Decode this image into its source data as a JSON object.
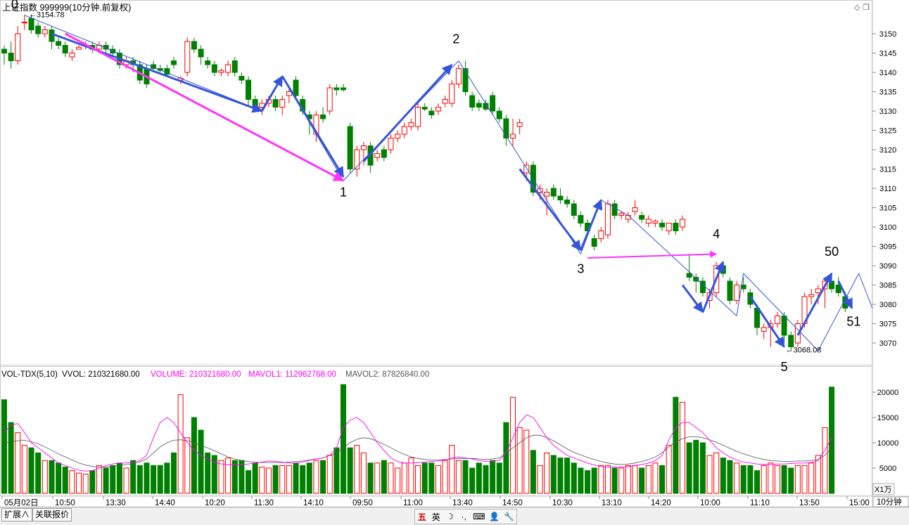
{
  "chart_data": [
    {
      "type": "candlestick",
      "title": "上证指数 999999(10分钟.前复权)",
      "yticks": [
        3150,
        3145,
        3140,
        3135,
        3130,
        3125,
        3120,
        3115,
        3110,
        3105,
        3100,
        3095,
        3090,
        3085,
        3080,
        3075,
        3070
      ],
      "xticks": [
        "05月02日",
        "10:50",
        "13:30",
        "14:40",
        "10:20",
        "11:30",
        "14:10",
        "09:50",
        "11:00",
        "13:40",
        "14:50",
        "10:30",
        "13:10",
        "14:20",
        "10:00",
        "11:10",
        "13:50",
        "15:00"
      ],
      "period_label": "10分钟",
      "high_label": "3154.78",
      "low_label": "3068.08",
      "wave_labels": [
        "0",
        "1",
        "2",
        "3",
        "4",
        "5",
        "50",
        "51"
      ],
      "colors": {
        "up": "#ff0000",
        "down": "#008000",
        "arrow_blue": "#3455db",
        "arrow_magenta": "#ff33ff",
        "mavol1": "#ff00ff",
        "mavol2": "#555555"
      },
      "candles": [
        [
          3146,
          3147,
          3142,
          3145
        ],
        [
          3145,
          3148,
          3141,
          3143
        ],
        [
          3143,
          3152,
          3142,
          3150
        ],
        [
          3153,
          3155,
          3151,
          3153
        ],
        [
          3154,
          3155,
          3150,
          3151
        ],
        [
          3152,
          3153,
          3149,
          3150
        ],
        [
          3150,
          3152,
          3149,
          3151
        ],
        [
          3151,
          3152,
          3146,
          3148
        ],
        [
          3148,
          3149,
          3146,
          3147
        ],
        [
          3147,
          3148,
          3144,
          3145
        ],
        [
          3144,
          3146,
          3143,
          3145
        ],
        [
          3146,
          3147,
          3146,
          3146.5
        ],
        [
          3147,
          3148,
          3146,
          3147
        ],
        [
          3147,
          3148,
          3145,
          3146
        ],
        [
          3146,
          3148,
          3145,
          3147
        ],
        [
          3147,
          3148,
          3145,
          3146
        ],
        [
          3146,
          3147,
          3144,
          3145
        ],
        [
          3145,
          3146,
          3141,
          3142
        ],
        [
          3142,
          3144,
          3141,
          3143
        ],
        [
          3143,
          3144,
          3140,
          3142
        ],
        [
          3142,
          3143,
          3137,
          3138
        ],
        [
          3141,
          3142,
          3136,
          3137
        ],
        [
          3142,
          3143,
          3140,
          3141
        ],
        [
          3141,
          3142,
          3140,
          3140.5
        ],
        [
          3141,
          3142,
          3139,
          3139.5
        ],
        [
          3143,
          3144,
          3141,
          3142
        ],
        [
          3138,
          3139,
          3137,
          3138.5
        ],
        [
          3140,
          3149,
          3139,
          3148
        ],
        [
          3148,
          3149,
          3145,
          3146
        ],
        [
          3146,
          3147,
          3142,
          3144
        ],
        [
          3143,
          3144,
          3141,
          3142
        ],
        [
          3142,
          3143,
          3139,
          3140
        ],
        [
          3140,
          3141,
          3139,
          3140.5
        ],
        [
          3140,
          3143,
          3139,
          3142
        ],
        [
          3143,
          3144,
          3139,
          3140
        ],
        [
          3139,
          3140,
          3137,
          3138
        ],
        [
          3138,
          3139,
          3131,
          3133
        ],
        [
          3133,
          3134,
          3130,
          3131
        ],
        [
          3131,
          3133,
          3129,
          3132
        ],
        [
          3132,
          3134,
          3131,
          3133
        ],
        [
          3133,
          3134,
          3130,
          3131
        ],
        [
          3131,
          3134,
          3129,
          3133
        ],
        [
          3134,
          3136,
          3132,
          3135
        ],
        [
          3138,
          3139,
          3133,
          3134
        ],
        [
          3133,
          3134,
          3129,
          3130
        ],
        [
          3129,
          3130,
          3124,
          3128
        ],
        [
          3124,
          3130,
          3122,
          3129
        ],
        [
          3129,
          3131,
          3127,
          3128
        ],
        [
          3130,
          3137,
          3129,
          3136
        ],
        [
          3136,
          3137,
          3134,
          3135.5
        ],
        [
          3136,
          3137,
          3135,
          3135.5
        ],
        [
          3126,
          3127,
          3114,
          3115
        ],
        [
          3115,
          3121,
          3113,
          3120
        ],
        [
          3120,
          3122,
          3116,
          3121
        ],
        [
          3121,
          3122,
          3114,
          3116
        ],
        [
          3118,
          3120,
          3117,
          3119
        ],
        [
          3120,
          3121,
          3117,
          3118
        ],
        [
          3120,
          3124,
          3119,
          3123
        ],
        [
          3123,
          3125,
          3122,
          3124
        ],
        [
          3124,
          3127,
          3123,
          3126
        ],
        [
          3126,
          3128,
          3125,
          3127
        ],
        [
          3126,
          3132,
          3125,
          3131
        ],
        [
          3131,
          3132,
          3130,
          3130.5
        ],
        [
          3130,
          3131,
          3128,
          3129
        ],
        [
          3130,
          3132,
          3129,
          3131
        ],
        [
          3132,
          3134,
          3131,
          3133
        ],
        [
          3132,
          3138,
          3131,
          3137
        ],
        [
          3137,
          3142,
          3136,
          3141
        ],
        [
          3141,
          3143,
          3134,
          3135
        ],
        [
          3134,
          3135,
          3130,
          3131
        ],
        [
          3132,
          3133,
          3130,
          3131
        ],
        [
          3132,
          3133,
          3130,
          3130.5
        ],
        [
          3134,
          3135,
          3129,
          3130
        ],
        [
          3130,
          3131,
          3127,
          3128
        ],
        [
          3128,
          3129,
          3121,
          3123
        ],
        [
          3123,
          3128,
          3121,
          3124
        ],
        [
          3126,
          3128,
          3124,
          3127
        ],
        [
          3114,
          3117,
          3112,
          3116
        ],
        [
          3116,
          3117,
          3108,
          3109
        ],
        [
          3109,
          3111,
          3107,
          3110
        ],
        [
          3108,
          3110,
          3103,
          3109
        ],
        [
          3110,
          3111,
          3107,
          3108
        ],
        [
          3108,
          3110,
          3106,
          3107
        ],
        [
          3107,
          3108,
          3105,
          3106
        ],
        [
          3106,
          3107,
          3102,
          3103
        ],
        [
          3103,
          3104,
          3100,
          3101
        ],
        [
          3101,
          3102,
          3098,
          3099
        ],
        [
          3097,
          3098,
          3094,
          3095
        ],
        [
          3097,
          3100,
          3096,
          3099
        ],
        [
          3098,
          3107,
          3097,
          3106
        ],
        [
          3106,
          3107,
          3102,
          3103
        ],
        [
          3103,
          3104,
          3102,
          3103.5
        ],
        [
          3102,
          3104,
          3101,
          3103
        ],
        [
          3104,
          3107,
          3103,
          3105
        ],
        [
          3103,
          3104,
          3101,
          3102
        ],
        [
          3101,
          3103,
          3100,
          3102
        ],
        [
          3101,
          3102,
          3100,
          3101.5
        ],
        [
          3101,
          3102,
          3099,
          3100
        ],
        [
          3099,
          3101,
          3098,
          3101
        ],
        [
          3101,
          3102,
          3098,
          3099
        ],
        [
          3100,
          3103,
          3099,
          3102
        ],
        [
          3088,
          3093,
          3086,
          3087
        ],
        [
          3087,
          3088,
          3083,
          3086
        ],
        [
          3086,
          3087,
          3082,
          3083
        ],
        [
          3081,
          3084,
          3079,
          3083
        ],
        [
          3083,
          3091,
          3082,
          3090
        ],
        [
          3090,
          3091,
          3087,
          3088
        ],
        [
          3086,
          3087,
          3080,
          3081
        ],
        [
          3081,
          3086,
          3080,
          3085
        ],
        [
          3085,
          3087,
          3083,
          3084
        ],
        [
          3083,
          3084,
          3079,
          3080
        ],
        [
          3079,
          3080,
          3072,
          3074
        ],
        [
          3073,
          3075,
          3071,
          3074
        ],
        [
          3074,
          3076,
          3069,
          3075
        ],
        [
          3075,
          3078,
          3074,
          3077
        ],
        [
          3077,
          3078,
          3070,
          3072
        ],
        [
          3072,
          3073,
          3068,
          3069
        ],
        [
          3070,
          3076,
          3069,
          3075
        ],
        [
          3075,
          3083,
          3074,
          3082
        ],
        [
          3082,
          3084,
          3080,
          3082.5
        ],
        [
          3083,
          3085,
          3080,
          3084
        ],
        [
          3084,
          3087,
          3079,
          3086
        ],
        [
          3086,
          3088,
          3083,
          3084
        ],
        [
          3085,
          3087,
          3082,
          3083
        ],
        [
          3082,
          3083,
          3078,
          3079
        ]
      ],
      "volume": {
        "label": "VOL-TDX(5,10)",
        "vvol": "VVOL: 210321680.00",
        "volume": "VOLUME: 210321680.00",
        "mavol1": "MAVOL1: 112962768.00",
        "mavol2": "MAVOL2: 87826840.00",
        "unit": "X1万",
        "yticks": [
          20000,
          15000,
          10000,
          5000
        ],
        "values": [
          18500,
          14000,
          12000,
          9500,
          9000,
          8000,
          6500,
          6500,
          6000,
          5200,
          4500,
          4000,
          3800,
          4500,
          5500,
          5000,
          5500,
          6000,
          5000,
          6500,
          5500,
          6000,
          5500,
          5500,
          6000,
          8000,
          19500,
          11000,
          15000,
          12500,
          8000,
          7500,
          6500,
          7000,
          6500,
          6500,
          4500,
          6000,
          5200,
          5000,
          5500,
          5500,
          5500,
          6000,
          5500,
          6000,
          6500,
          6500,
          7500,
          9000,
          21500,
          9000,
          9500,
          8000,
          6000,
          6000,
          6500,
          6000,
          5000,
          6000,
          7000,
          5500,
          6000,
          6000,
          5500,
          6500,
          9500,
          6500,
          6500,
          5000,
          6000,
          5500,
          6500,
          6000,
          14000,
          19000,
          13000,
          12500,
          8500,
          5500,
          8000,
          7500,
          7000,
          7000,
          6000,
          5000,
          4500,
          5000,
          5500,
          5500,
          5000,
          5000,
          5500,
          5500,
          5000,
          5500,
          6000,
          5500,
          9500,
          19000,
          18000,
          10000,
          10500,
          10000,
          7500,
          8000,
          7000,
          6500,
          6000,
          5500,
          5500,
          4500,
          5500,
          6000,
          5500,
          5500,
          5000,
          5500,
          5500,
          6000,
          7500,
          13000,
          21000
        ],
        "mavol1_values": [
          12000,
          13500,
          13800,
          12000,
          10000,
          9000,
          8000,
          7000,
          6000,
          5500,
          5000,
          4600,
          4400,
          4500,
          5000,
          5500,
          5800,
          6000,
          6000,
          6200,
          6500,
          7500,
          11000,
          14000,
          15000,
          14000,
          12000,
          10000,
          8500,
          7500,
          6800,
          6200,
          5800,
          5700,
          5600,
          5700,
          5800,
          6000,
          6200,
          6400,
          6300,
          6200,
          6000,
          6000,
          6200,
          6500,
          6800,
          7000,
          7500,
          9000,
          13000,
          14500,
          15000,
          14000,
          12000,
          10000,
          8500,
          7000,
          6300,
          6000,
          6000,
          6100,
          6200,
          6300,
          6400,
          6600,
          7000,
          7200,
          7000,
          6800,
          6500,
          6300,
          6300,
          6500,
          8000,
          11000,
          14000,
          15500,
          15000,
          13000,
          11000,
          9500,
          8500,
          7500,
          7000,
          6500,
          6000,
          5600,
          5300,
          5200,
          5200,
          5200,
          5300,
          5500,
          5700,
          6000,
          6500,
          7500,
          10500,
          13000,
          14000,
          14000,
          13000,
          12000,
          10500,
          9000,
          8000,
          7200,
          6600,
          6200,
          6000,
          5800,
          5700,
          5700,
          5800,
          5800,
          5900,
          6000,
          6000,
          6100,
          6500,
          8500,
          11000
        ],
        "mavol2_values": [
          10000,
          10200,
          10400,
          10500,
          10200,
          9800,
          9200,
          8500,
          7800,
          7200,
          6600,
          6000,
          5600,
          5300,
          5200,
          5200,
          5300,
          5500,
          5700,
          5900,
          6200,
          6800,
          8000,
          9200,
          10000,
          10500,
          10600,
          10400,
          10000,
          9500,
          9000,
          8400,
          7800,
          7200,
          6800,
          6500,
          6300,
          6200,
          6100,
          6100,
          6100,
          6100,
          6200,
          6300,
          6400,
          6600,
          6800,
          7000,
          7500,
          8000,
          9000,
          10000,
          10700,
          11000,
          10800,
          10300,
          9700,
          9000,
          8300,
          7700,
          7200,
          6900,
          6700,
          6600,
          6600,
          6700,
          6800,
          6900,
          6900,
          6900,
          6800,
          6700,
          6800,
          7000,
          8000,
          9000,
          10000,
          11000,
          11500,
          11500,
          11000,
          10400,
          9600,
          8800,
          8100,
          7600,
          7100,
          6700,
          6300,
          6000,
          5800,
          5700,
          5800,
          6000,
          6300,
          6700,
          7200,
          8000,
          9200,
          10200,
          10800,
          11200,
          11200,
          11000,
          10600,
          10100,
          9500,
          8900,
          8300,
          7800,
          7400,
          7000,
          6700,
          6500,
          6400,
          6300,
          6300,
          6400,
          6400,
          6500,
          6700,
          7500,
          9000
        ]
      }
    }
  ],
  "window_buttons": [
    "◇",
    "❐"
  ],
  "bottom_tabs": [
    "扩展∧",
    "关联报价"
  ],
  "ime_items": [
    "五",
    "英",
    "☽",
    "·,",
    "⌨",
    "👤",
    "🔧"
  ]
}
